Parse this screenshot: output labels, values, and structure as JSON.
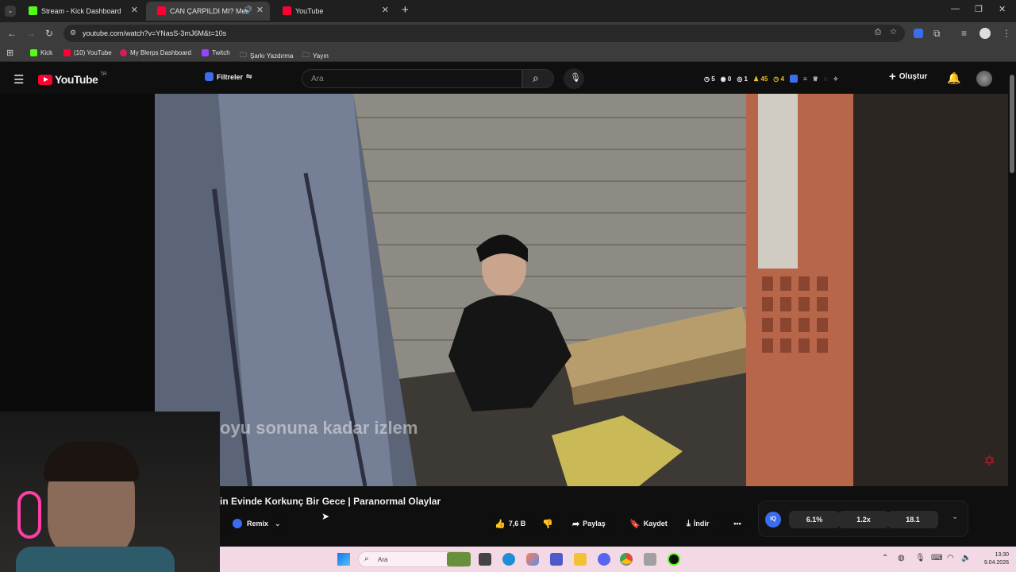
{
  "browser": {
    "tabs": [
      {
        "title": "Stream - Kick Dashboard",
        "icon": "kick-icon"
      },
      {
        "title": "CAN ÇARPILDI MI? Mezarlı",
        "icon": "youtube-icon"
      },
      {
        "title": "YouTube",
        "icon": "youtube-icon"
      }
    ],
    "new_tab": "+",
    "url": "youtube.com/watch?v=YNasS-3mJ6M&t=10s",
    "bookmarks": [
      "Kick",
      "(10) YouTube",
      "My Blerps Dashboard",
      "Twitch",
      "Şarkı Yazdırma",
      "Yayın"
    ]
  },
  "youtube": {
    "logo_text": "YouTube",
    "country": "TR",
    "filter_label": "Filtreler",
    "search_placeholder": "Ara",
    "stats": [
      "5",
      "0",
      "1",
      "45",
      "4"
    ],
    "create_label": "Oluştur"
  },
  "video": {
    "overlay_text": "oyu sonuna kadar izlem",
    "title": "in Evinde Korkunç Bir Gece | Paranormal Olaylar",
    "remix_label": "Remix",
    "like_count": "7,6 B",
    "share_label": "Paylaş",
    "save_label": "Kaydet",
    "download_label": "İndir"
  },
  "extension": {
    "values": [
      "6.1%",
      "1.2x",
      "18.1"
    ]
  },
  "taskbar": {
    "search_placeholder": "Ara",
    "time": "13:30",
    "date": "9.04.2026"
  },
  "colors": {
    "youtube_red": "#ff0033",
    "kick_green": "#53fc18",
    "stats_yellow": "#f5c518"
  }
}
